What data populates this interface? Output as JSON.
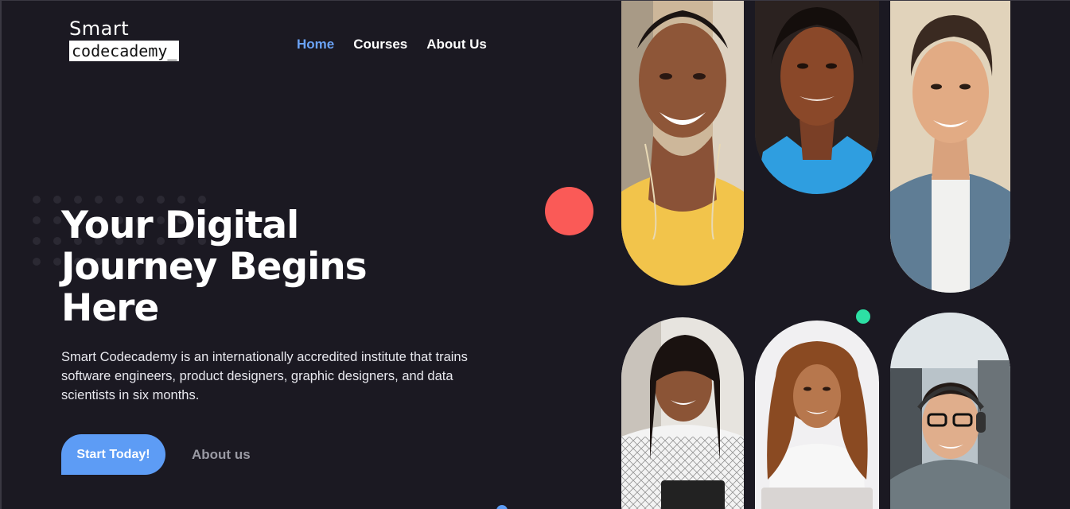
{
  "logo": {
    "line1": "Smart",
    "line2": "codecademy_"
  },
  "nav": {
    "items": [
      {
        "label": "Home",
        "active": true
      },
      {
        "label": "Courses",
        "active": false
      },
      {
        "label": "About Us",
        "active": false
      }
    ]
  },
  "hero": {
    "title_line1": "Your Digital",
    "title_line2": "Journey Begins",
    "title_line3": "Here",
    "description": "Smart Codecademy is an internationally accredited institute that trains software engineers, product designers, graphic designers, and data scientists in six months.",
    "primary_button": "Start Today!",
    "secondary_link": "About us"
  },
  "colors": {
    "background": "#1b1922",
    "accent_blue": "#5d9cf5",
    "active_nav": "#6aa2f5",
    "coral": "#fa5a57",
    "mint": "#2de0a4"
  }
}
